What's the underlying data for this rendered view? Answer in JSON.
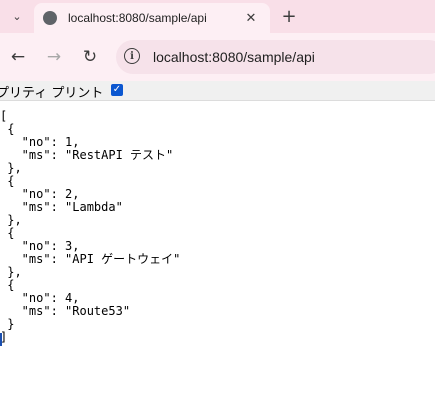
{
  "browser": {
    "tab_title": "localhost:8080/sample/api",
    "url": "localhost:8080/sample/api"
  },
  "pretty_print": {
    "label": "プリティ プリント",
    "checked": true
  },
  "json_text": {
    "lines": [
      "[",
      " {",
      "   \"no\": 1,",
      "   \"ms\": \"RestAPI テスト\"",
      " },",
      " {",
      "   \"no\": 2,",
      "   \"ms\": \"Lambda\"",
      " },",
      " {",
      "   \"no\": 3,",
      "   \"ms\": \"API ゲートウェイ\"",
      " },",
      " {",
      "   \"no\": 4,",
      "   \"ms\": \"Route53\"",
      " }",
      "]"
    ]
  }
}
